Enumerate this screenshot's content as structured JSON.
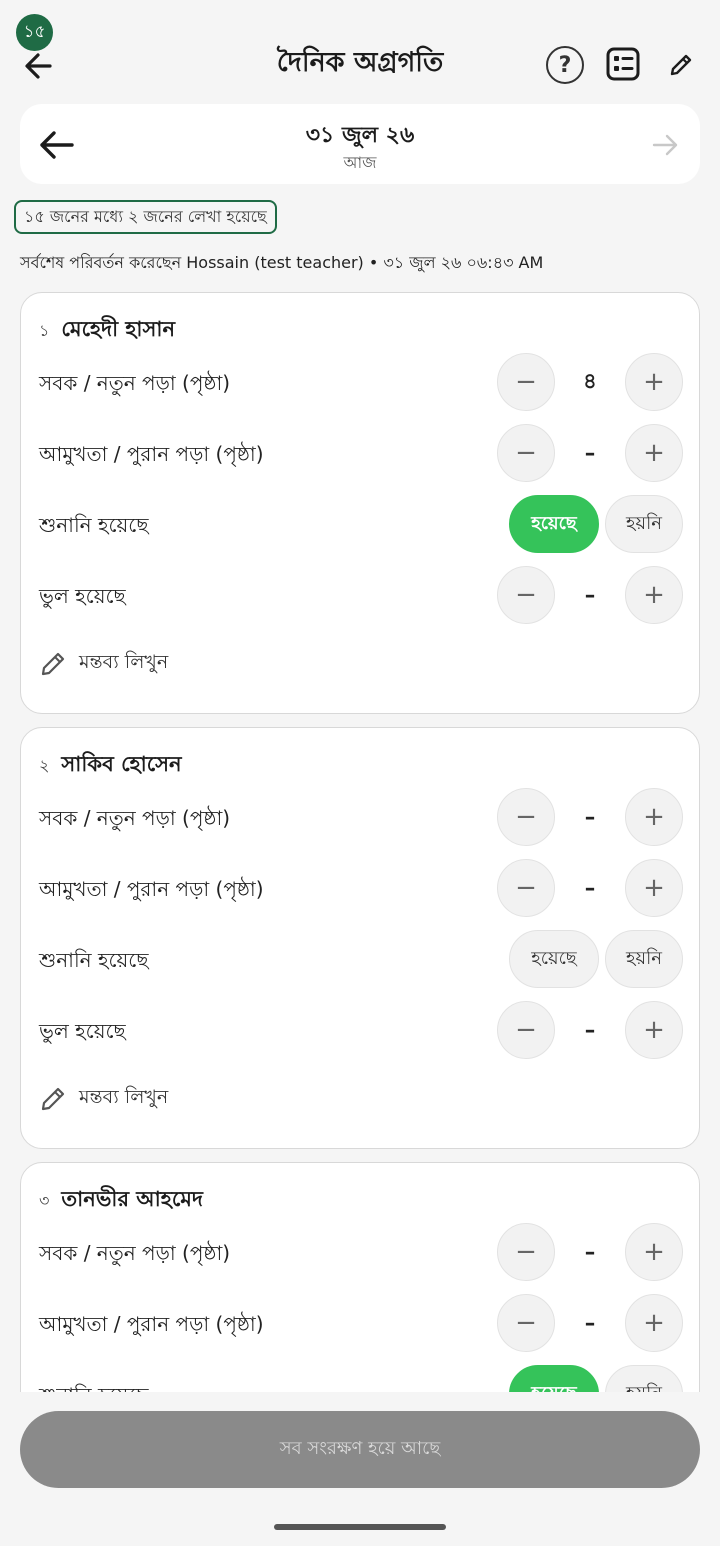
{
  "header": {
    "badge": "১৫",
    "title": "দৈনিক অগ্রগতি"
  },
  "date_nav": {
    "date": "৩১ জুল ২৬",
    "relative": "আজ"
  },
  "summary": {
    "progress": "১৫ জনের মধ্যে ২ জনের লেখা হয়েছে",
    "last_modified": "সর্বশেষ পরিবর্তন করেছেন Hossain (test teacher) • ৩১ জুল ২৬ ০৬:৪৩ AM"
  },
  "labels": {
    "sabak": "সবক / নতুন পড়া (পৃষ্ঠা)",
    "amukhta": "আমুখতা / পুরান পড়া (পৃষ্ঠা)",
    "shunani": "শুনানি হয়েছে",
    "mistakes": "ভুল হয়েছে",
    "yes": "হয়েছে",
    "no": "হয়নি",
    "comment": "মন্তব্য লিখুন",
    "minus": "−",
    "plus": "+"
  },
  "students": [
    {
      "num": "১",
      "name": "মেহেদী হাসান",
      "sabak": "৪",
      "amukhta": "–",
      "shunani": "yes",
      "mistakes": "–"
    },
    {
      "num": "২",
      "name": "সাকিব হোসেন",
      "sabak": "–",
      "amukhta": "–",
      "shunani": "none",
      "mistakes": "–"
    },
    {
      "num": "৩",
      "name": "তানভীর আহমেদ",
      "sabak": "–",
      "amukhta": "–",
      "shunani": "yes",
      "mistakes": "–"
    }
  ],
  "footer": {
    "save_label": "সব সংরক্ষণ হয়ে আছে"
  },
  "colors": {
    "brand_green": "#1f6b45",
    "active_green": "#35c35a",
    "disabled_button": "#8a8a8a"
  }
}
